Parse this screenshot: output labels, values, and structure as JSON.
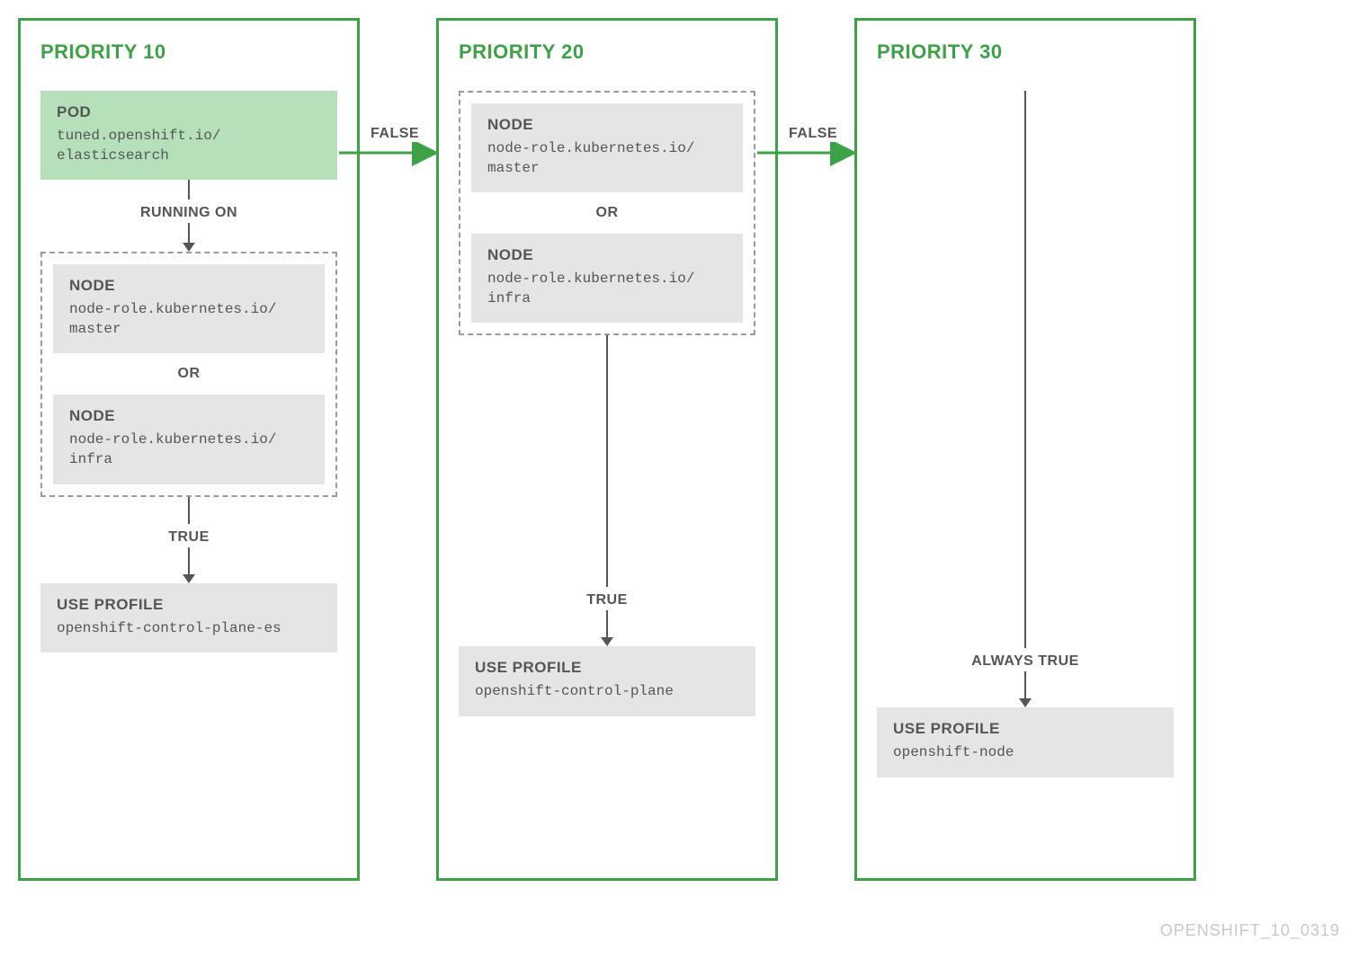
{
  "footer": "OPENSHIFT_10_0319",
  "labels": {
    "running_on": "RUNNING ON",
    "or": "OR",
    "true": "TRUE",
    "false": "FALSE",
    "always_true": "ALWAYS TRUE",
    "use_profile": "USE PROFILE",
    "pod": "POD",
    "node": "NODE"
  },
  "columns": [
    {
      "title": "PRIORITY 10",
      "pod": "tuned.openshift.io/\nelasticsearch",
      "nodes": [
        "node-role.kubernetes.io/\nmaster",
        "node-role.kubernetes.io/\ninfra"
      ],
      "profile": "openshift-control-plane-es"
    },
    {
      "title": "PRIORITY 20",
      "nodes": [
        "node-role.kubernetes.io/\nmaster",
        "node-role.kubernetes.io/\ninfra"
      ],
      "profile": "openshift-control-plane"
    },
    {
      "title": "PRIORITY 30",
      "profile": "openshift-node"
    }
  ]
}
